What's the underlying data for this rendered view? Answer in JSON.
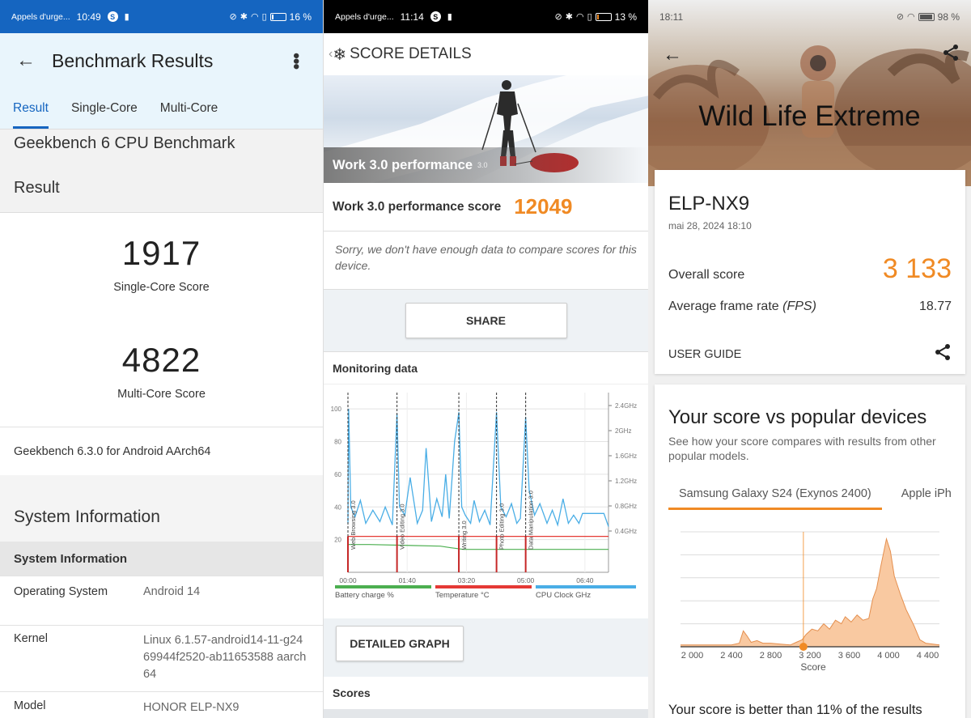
{
  "panel1": {
    "status": {
      "carrier": "Appels d'urge...",
      "time": "10:49",
      "battery": "16 %",
      "battery_level": 0.16
    },
    "title": "Benchmark Results",
    "tabs": [
      {
        "label": "Result",
        "active": true
      },
      {
        "label": "Single-Core"
      },
      {
        "label": "Multi-Core"
      }
    ],
    "benchmark_title": "Geekbench 6 CPU Benchmark",
    "result_header": "Result",
    "single_core": {
      "value": "1917",
      "label": "Single-Core Score"
    },
    "multi_core": {
      "value": "4822",
      "label": "Multi-Core Score"
    },
    "version": "Geekbench 6.3.0 for Android AArch64",
    "system_info_title": "System Information",
    "system_info_subheader": "System Information",
    "rows": [
      {
        "key": "Operating System",
        "value": "Android 14"
      },
      {
        "key": "Kernel",
        "value": "Linux 6.1.57-android14-11-g2469944f2520-ab11653588 aarch64"
      },
      {
        "key": "Model",
        "value": "HONOR ELP-NX9"
      }
    ]
  },
  "panel2": {
    "status": {
      "carrier": "Appels d'urge...",
      "time": "11:14",
      "battery": "13 %",
      "battery_level": 0.13
    },
    "header": "SCORE DETAILS",
    "hero_label": "Work 3.0 performance",
    "hero_version": "3.0",
    "score_label": "Work 3.0 performance score",
    "score_value": "12049",
    "note": "Sorry, we don't have enough data to compare scores for this device.",
    "share": "SHARE",
    "monitoring_title": "Monitoring data",
    "detailed_graph": "DETAILED GRAPH",
    "scores_title": "Scores",
    "chart_data": {
      "type": "line",
      "x_ticks": [
        "00:00",
        "01:40",
        "03:20",
        "05:00",
        "06:40"
      ],
      "y_left_ticks": [
        "100",
        "80",
        "60",
        "40",
        "20"
      ],
      "y_left_range": [
        0,
        110
      ],
      "y_right_ticks": [
        "2.4GHz",
        "2GHz",
        "1.6GHz",
        "1.2GHz",
        "0.8GHz",
        "0.4GHz"
      ],
      "markers": [
        {
          "label": "Web Browsing 3.0",
          "t": 0.0
        },
        {
          "label": "Video Editing 3.0",
          "t": 1.38
        },
        {
          "label": "Writing 3.0",
          "t": 3.12
        },
        {
          "label": "Photo Editing 3.0",
          "t": 4.18
        },
        {
          "label": "Data Manipulation 3.0",
          "t": 5.0
        }
      ],
      "x_range": [
        0,
        7.33
      ],
      "series": [
        {
          "name": "Battery charge %",
          "color": "#4caf50",
          "values": [
            [
              0,
              17
            ],
            [
              0.6,
              17
            ],
            [
              2.6,
              16
            ],
            [
              2.9,
              15
            ],
            [
              3.25,
              14
            ],
            [
              4.3,
              14
            ],
            [
              5.5,
              14
            ],
            [
              7.33,
              14
            ]
          ]
        },
        {
          "name": "Temperature °C",
          "color": "#e53935",
          "values": [
            [
              0,
              22
            ],
            [
              0.05,
              22
            ],
            [
              3.25,
              22
            ],
            [
              4.3,
              22
            ],
            [
              7.33,
              22
            ]
          ]
        },
        {
          "name": "CPU Clock GHz",
          "color": "#4aaee6",
          "values": [
            [
              0,
              30
            ],
            [
              0.02,
              100
            ],
            [
              0.08,
              40
            ],
            [
              0.2,
              34
            ],
            [
              0.35,
              44
            ],
            [
              0.5,
              30
            ],
            [
              0.7,
              38
            ],
            [
              0.9,
              31
            ],
            [
              1.05,
              40
            ],
            [
              1.25,
              29
            ],
            [
              1.38,
              97
            ],
            [
              1.45,
              40
            ],
            [
              1.6,
              35
            ],
            [
              1.75,
              58
            ],
            [
              1.95,
              30
            ],
            [
              2.1,
              38
            ],
            [
              2.2,
              76
            ],
            [
              2.35,
              31
            ],
            [
              2.5,
              45
            ],
            [
              2.65,
              34
            ],
            [
              2.75,
              60
            ],
            [
              2.85,
              33
            ],
            [
              3.0,
              80
            ],
            [
              3.12,
              98
            ],
            [
              3.2,
              40
            ],
            [
              3.3,
              35
            ],
            [
              3.45,
              30
            ],
            [
              3.55,
              44
            ],
            [
              3.7,
              31
            ],
            [
              3.85,
              38
            ],
            [
              4.0,
              29
            ],
            [
              4.18,
              98
            ],
            [
              4.3,
              40
            ],
            [
              4.45,
              34
            ],
            [
              4.6,
              42
            ],
            [
              4.75,
              30
            ],
            [
              4.85,
              33
            ],
            [
              5.0,
              95
            ],
            [
              5.1,
              50
            ],
            [
              5.25,
              35
            ],
            [
              5.4,
              42
            ],
            [
              5.6,
              30
            ],
            [
              5.75,
              38
            ],
            [
              5.9,
              29
            ],
            [
              6.05,
              45
            ],
            [
              6.2,
              30
            ],
            [
              6.35,
              35
            ],
            [
              6.5,
              30
            ],
            [
              6.6,
              36
            ],
            [
              6.9,
              36
            ],
            [
              7.2,
              36
            ],
            [
              7.33,
              28
            ]
          ]
        }
      ]
    }
  },
  "panel3": {
    "status": {
      "time": "18:11",
      "battery": "98 %",
      "battery_level": 0.98
    },
    "title": "Wild Life Extreme",
    "device": "ELP-NX9",
    "date": "mai 28, 2024 18:10",
    "overall_label": "Overall score",
    "overall_value": "3 133",
    "fps_label": "Average frame rate",
    "fps_unit": "(FPS)",
    "fps_value": "18.77",
    "user_guide": "USER GUIDE",
    "compare_title": "Your score vs popular devices",
    "compare_sub": "See how your score compares with results from other popular models.",
    "tabs": [
      {
        "label": "Samsung Galaxy S24 (Exynos 2400)",
        "active": true
      },
      {
        "label": "Apple iPh"
      }
    ],
    "footer": "Your score is better than 11% of the results",
    "accent": "#f08a24",
    "chart_data": {
      "type": "area",
      "xlabel": "Score",
      "x_ticks": [
        2000,
        2400,
        2800,
        3200,
        3600,
        4000,
        4400
      ],
      "x_range": [
        1880,
        4520
      ],
      "marker": 3133,
      "values": [
        [
          1880,
          2
        ],
        [
          2400,
          2
        ],
        [
          2480,
          4
        ],
        [
          2520,
          18
        ],
        [
          2560,
          12
        ],
        [
          2600,
          5
        ],
        [
          2660,
          7
        ],
        [
          2720,
          4
        ],
        [
          2800,
          4
        ],
        [
          2900,
          3
        ],
        [
          3000,
          2
        ],
        [
          3060,
          5
        ],
        [
          3120,
          8
        ],
        [
          3160,
          14
        ],
        [
          3220,
          20
        ],
        [
          3280,
          18
        ],
        [
          3340,
          26
        ],
        [
          3400,
          20
        ],
        [
          3460,
          30
        ],
        [
          3520,
          26
        ],
        [
          3560,
          34
        ],
        [
          3620,
          28
        ],
        [
          3680,
          36
        ],
        [
          3740,
          30
        ],
        [
          3800,
          32
        ],
        [
          3840,
          54
        ],
        [
          3880,
          66
        ],
        [
          3920,
          90
        ],
        [
          3980,
          122
        ],
        [
          4020,
          108
        ],
        [
          4060,
          80
        ],
        [
          4120,
          60
        ],
        [
          4180,
          42
        ],
        [
          4260,
          24
        ],
        [
          4320,
          8
        ],
        [
          4380,
          4
        ],
        [
          4520,
          2
        ]
      ],
      "ylim": [
        0,
        130
      ]
    }
  }
}
